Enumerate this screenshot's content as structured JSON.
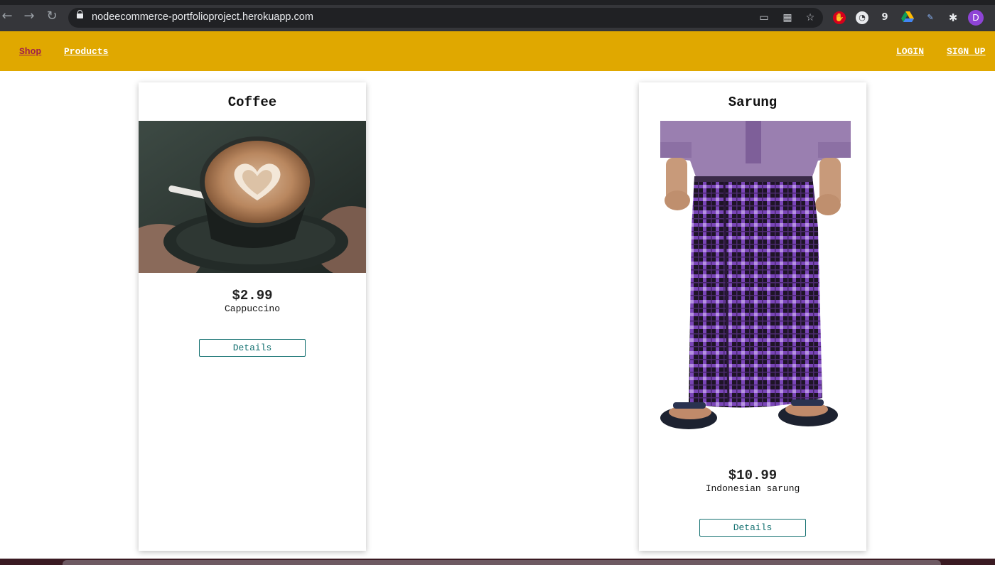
{
  "browser": {
    "url": "nodeecommerce-portfolioproject.herokuapp.com",
    "extension_badge": "9",
    "profile_initial": "D"
  },
  "nav": {
    "left": [
      {
        "label": "Shop",
        "active": true
      },
      {
        "label": "Products",
        "active": false
      }
    ],
    "right": [
      {
        "label": "LOGIN"
      },
      {
        "label": "SIGN UP"
      }
    ],
    "bar_color": "#e0a800",
    "active_color": "#a0204a"
  },
  "products": [
    {
      "title": "Coffee",
      "price": "$2.99",
      "description": "Cappuccino",
      "button": "Details",
      "image": "cappuccino-photo"
    },
    {
      "title": "Sarung",
      "price": "$10.99",
      "description": "Indonesian sarung",
      "button": "Details",
      "image": "sarung-photo"
    }
  ]
}
